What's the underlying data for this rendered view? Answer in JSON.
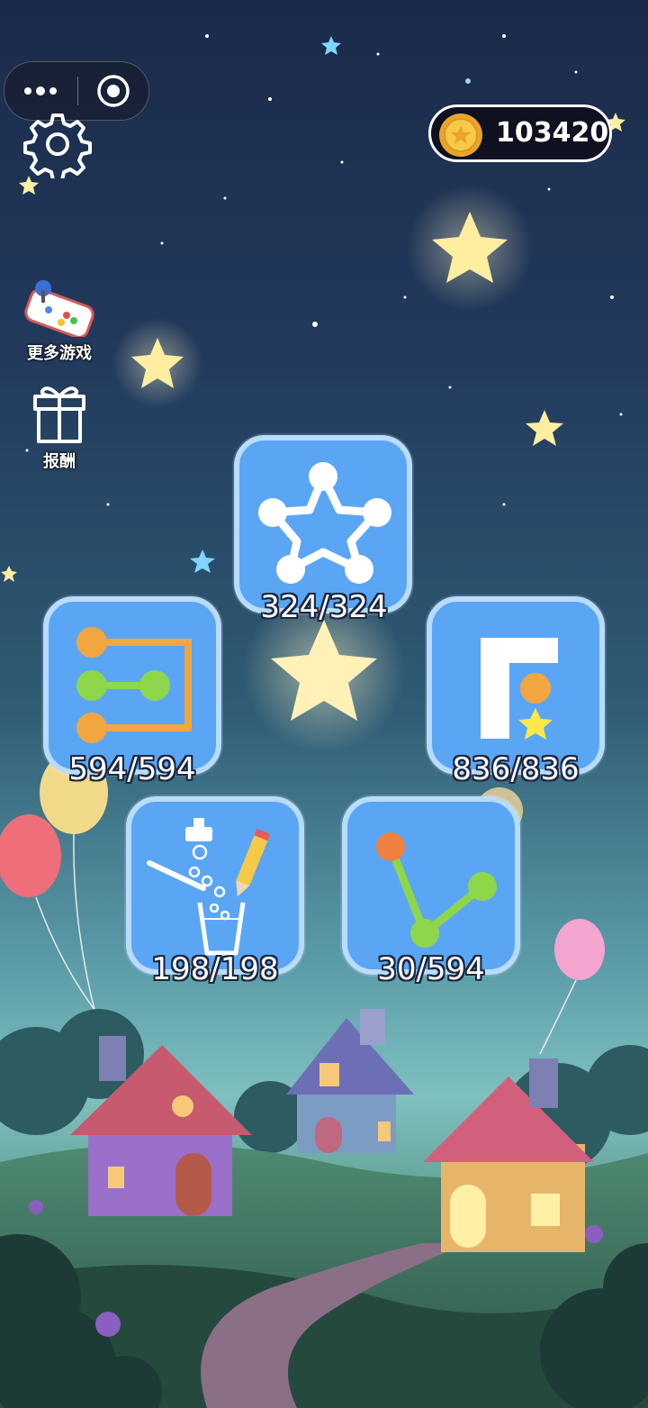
{
  "header": {
    "menu_icon": "more-dots-icon",
    "close_icon": "close-target-icon",
    "settings_icon": "gear-icon",
    "coins": "103420",
    "coin_icon": "gold-coin-icon"
  },
  "side_buttons": [
    {
      "label": "更多游戏",
      "icon": "gamepad-icon"
    },
    {
      "label": "报酬",
      "icon": "gift-icon"
    }
  ],
  "levels": [
    {
      "mode": "star-connect",
      "icon": "star-dots-icon",
      "count": "324/324"
    },
    {
      "mode": "line-connect",
      "icon": "dot-lines-icon",
      "count": "594/594"
    },
    {
      "mode": "block-slide",
      "icon": "block-star-icon",
      "count": "836/836"
    },
    {
      "mode": "draw-fill-cup",
      "icon": "pencil-cup-icon",
      "count": "198/198"
    },
    {
      "mode": "swing-connect",
      "icon": "swing-balls-icon",
      "count": "30/594"
    }
  ],
  "colors": {
    "tile": "#5aa6f4",
    "tile_border": "#b8dcff",
    "orange_ball": "#f2a640",
    "green_ball": "#8ed64a",
    "star": "#ffe88a"
  }
}
